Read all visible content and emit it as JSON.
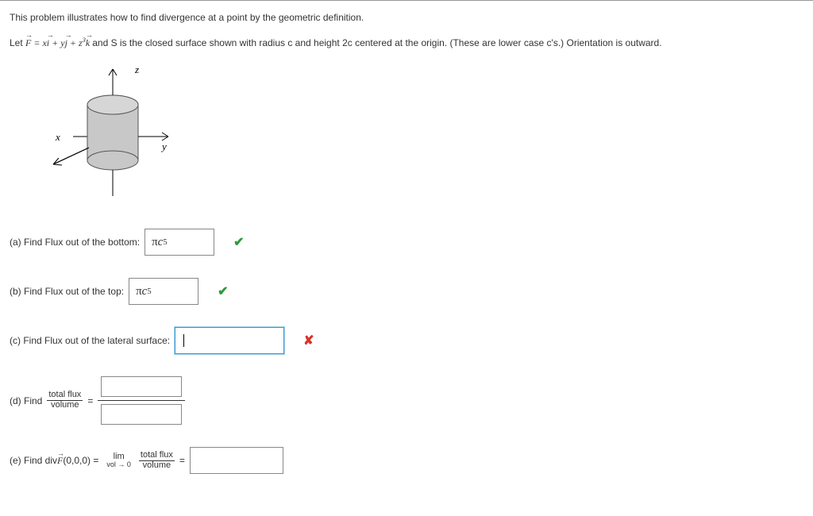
{
  "intro": "This problem illustrates how to find divergence at a point by the geometric definition.",
  "let_prefix": "Let  ",
  "vector_field_html": "F = x i + y j + z³ k",
  "let_suffix": "  and S is the closed surface shown with radius c and height 2c centered at the origin. (These are lower case c's.) Orientation is outward.",
  "diagram": {
    "z_label": "z",
    "x_label": "x",
    "y_label": "y"
  },
  "parts": {
    "a": {
      "label": "(a) Find Flux out of the bottom:",
      "answer": "πc⁵",
      "status": "correct"
    },
    "b": {
      "label": "(b) Find Flux out of the top:",
      "answer": "πc⁵",
      "status": "correct"
    },
    "c": {
      "label": "(c) Find Flux out of the lateral surface:",
      "answer": "",
      "status": "incorrect"
    },
    "d": {
      "label_prefix": "(d) Find ",
      "frac_num": "total flux",
      "frac_den": "volume",
      "equals": " = ",
      "answer_num": "",
      "answer_den": ""
    },
    "e": {
      "label_prefix": "(e) Find  div",
      "point": "(0,0,0) = ",
      "lim_top": "lim",
      "lim_bot": "vol → 0",
      "frac_num": "total flux",
      "frac_den": "volume",
      "equals": " = ",
      "answer": ""
    }
  }
}
